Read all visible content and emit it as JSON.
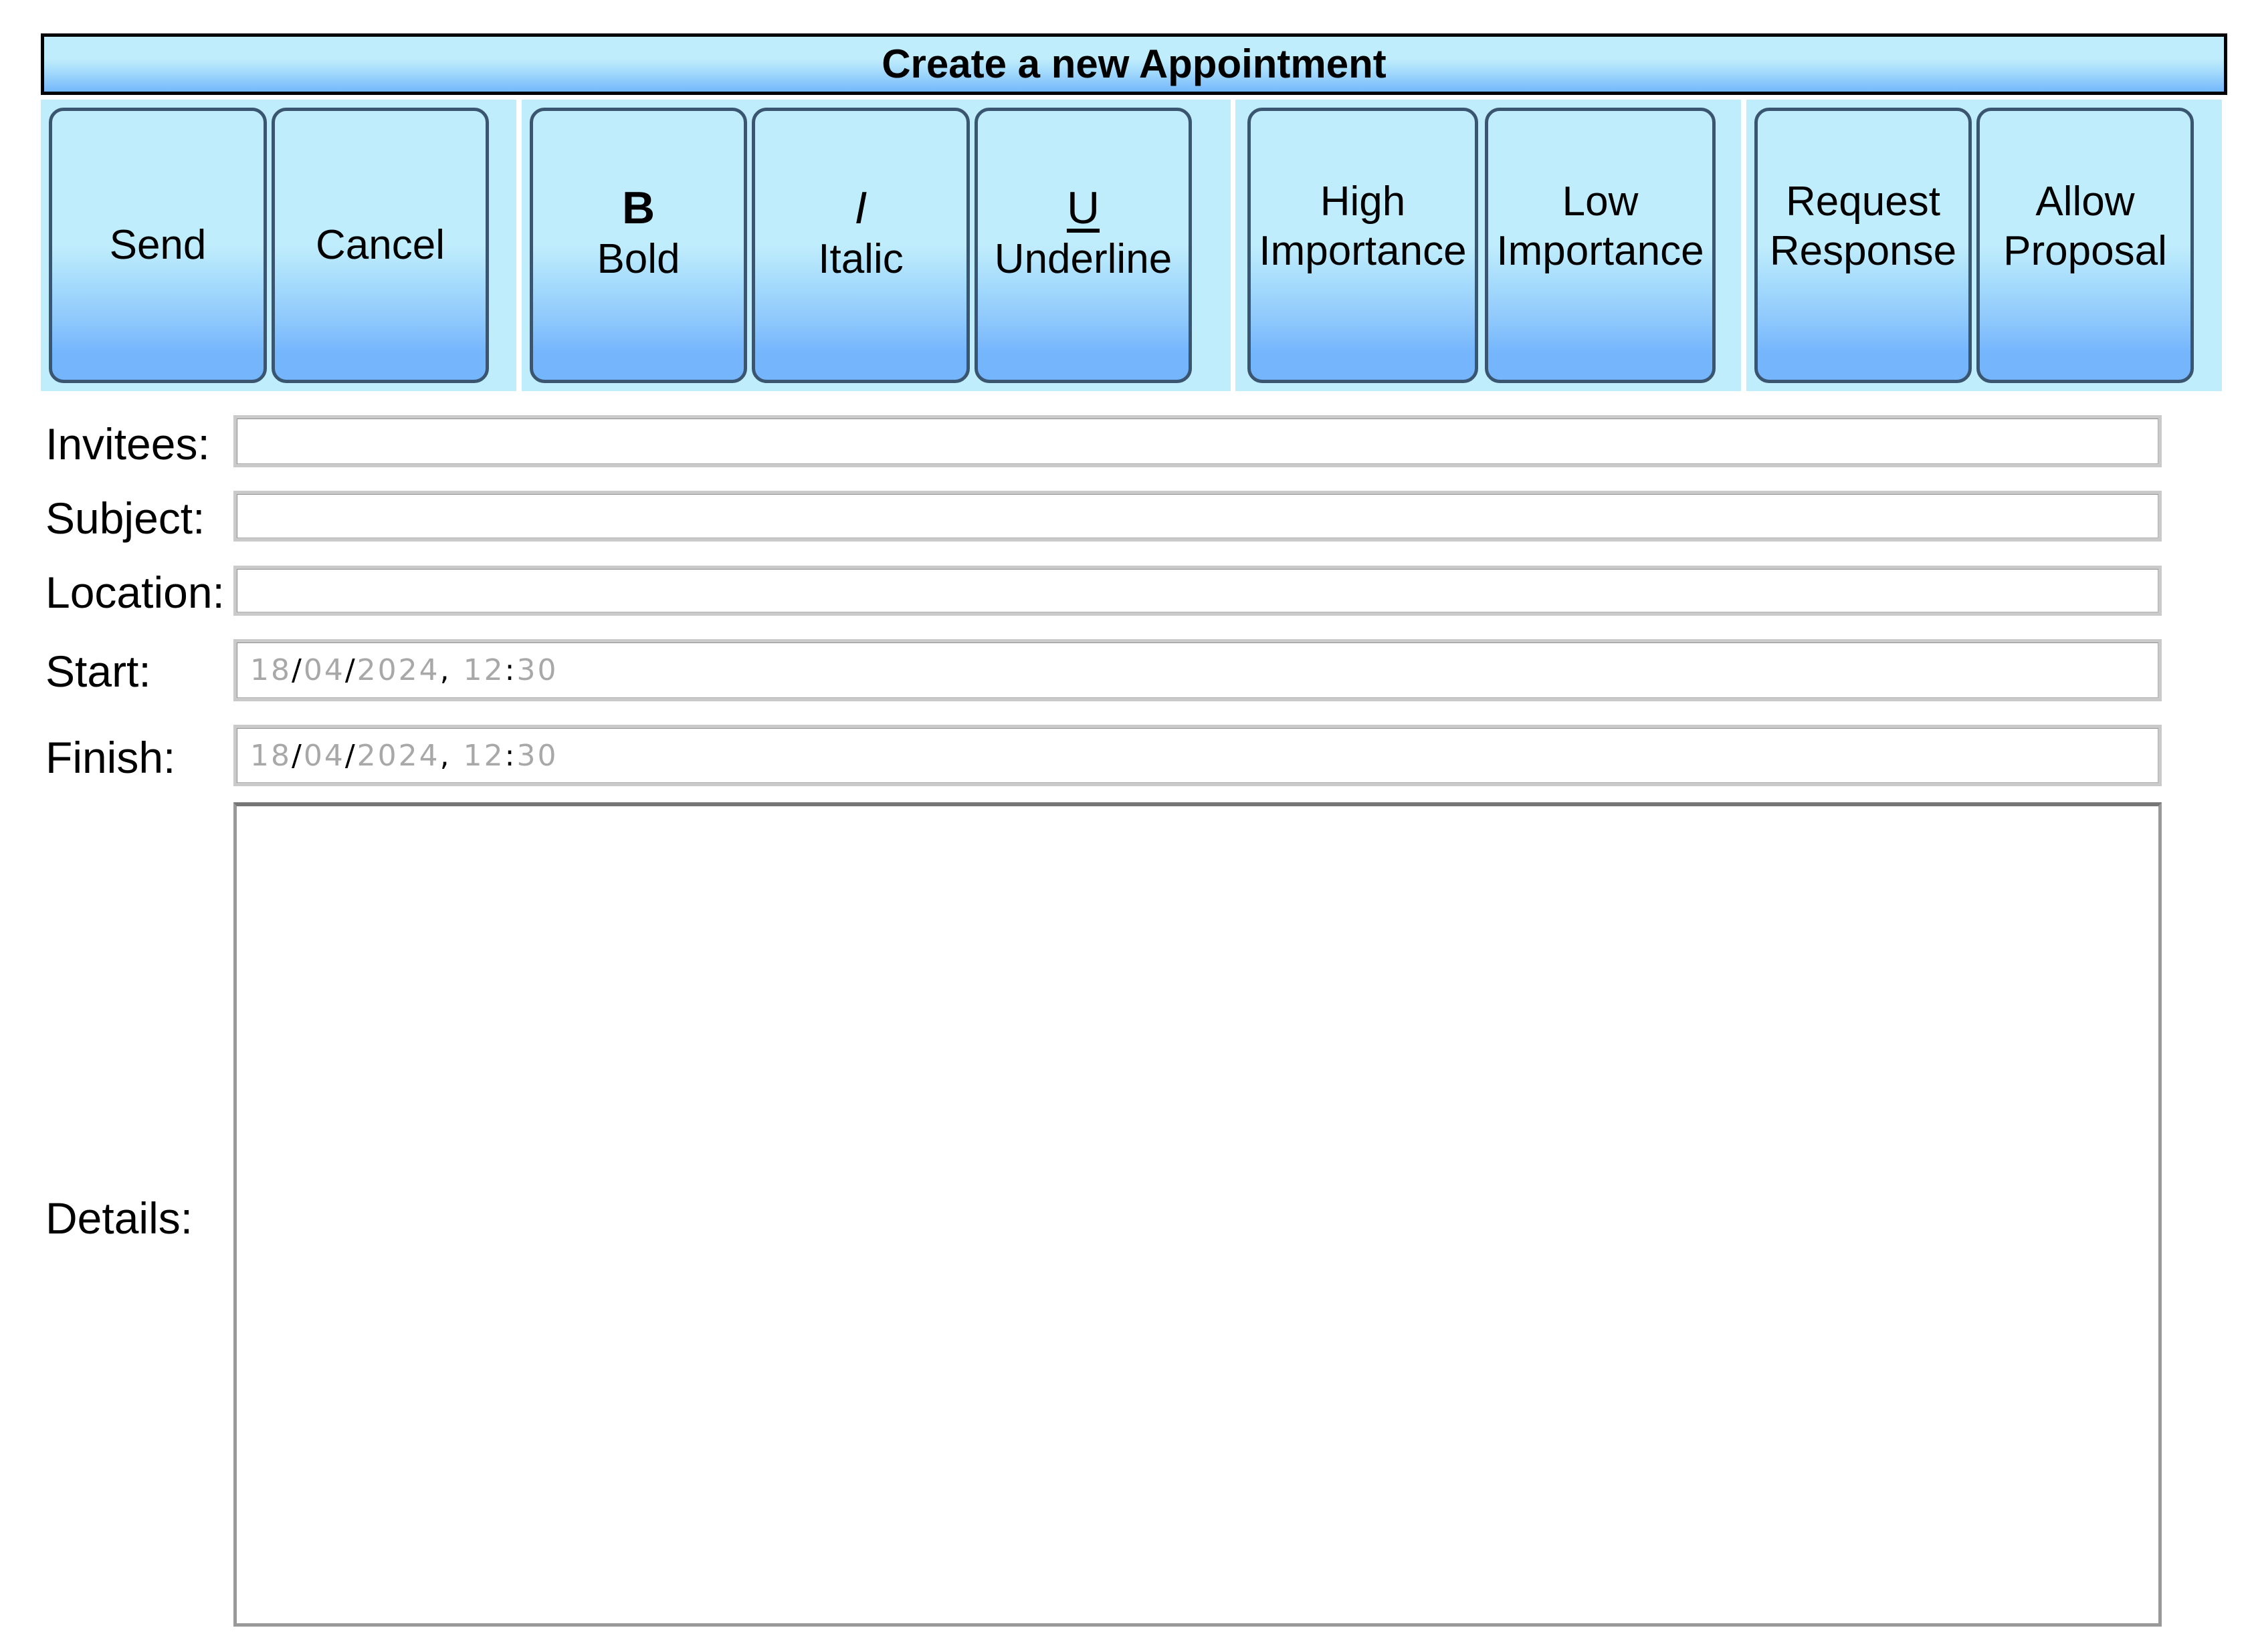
{
  "window": {
    "title": "Create a new Appointment"
  },
  "toolbar": {
    "groups": [
      {
        "name": "actions",
        "buttons": [
          {
            "label": "Send",
            "icon": null
          },
          {
            "label": "Cancel",
            "icon": null
          }
        ]
      },
      {
        "name": "formatting",
        "buttons": [
          {
            "label": "Bold",
            "icon": "bold-icon",
            "glyph": "B"
          },
          {
            "label": "Italic",
            "icon": "italic-icon",
            "glyph": "I"
          },
          {
            "label": "Underline",
            "icon": "underline-icon",
            "glyph": "U"
          }
        ]
      },
      {
        "name": "importance",
        "buttons": [
          {
            "label_line1": "High",
            "label_line2": "Importance"
          },
          {
            "label_line1": "Low",
            "label_line2": "Importance"
          }
        ]
      },
      {
        "name": "response-options",
        "buttons": [
          {
            "label_line1": "Request",
            "label_line2": "Response"
          },
          {
            "label_line1": "Allow",
            "label_line2": "Proposal"
          }
        ]
      }
    ]
  },
  "form": {
    "invitees": {
      "label": "Invitees:",
      "value": "",
      "placeholder": ""
    },
    "subject": {
      "label": "Subject:",
      "value": "",
      "placeholder": ""
    },
    "location": {
      "label": "Location:",
      "value": "",
      "placeholder": ""
    },
    "start": {
      "label": "Start:",
      "day": "18",
      "month": "04",
      "year": "2024",
      "hour": "12",
      "minute": "30",
      "sep_date": "/",
      "sep_datetime": ",",
      "sep_time": ":"
    },
    "finish": {
      "label": "Finish:",
      "day": "18",
      "month": "04",
      "year": "2024",
      "hour": "12",
      "minute": "30",
      "sep_date": "/",
      "sep_datetime": ",",
      "sep_time": ":"
    },
    "details": {
      "label": "Details:",
      "value": ""
    }
  },
  "colors": {
    "toolbar_bg": "#c0edfc",
    "gradient_bottom": "#74b5fc",
    "button_border": "#3a5570",
    "placeholder_digits": "#a8a8a8"
  }
}
